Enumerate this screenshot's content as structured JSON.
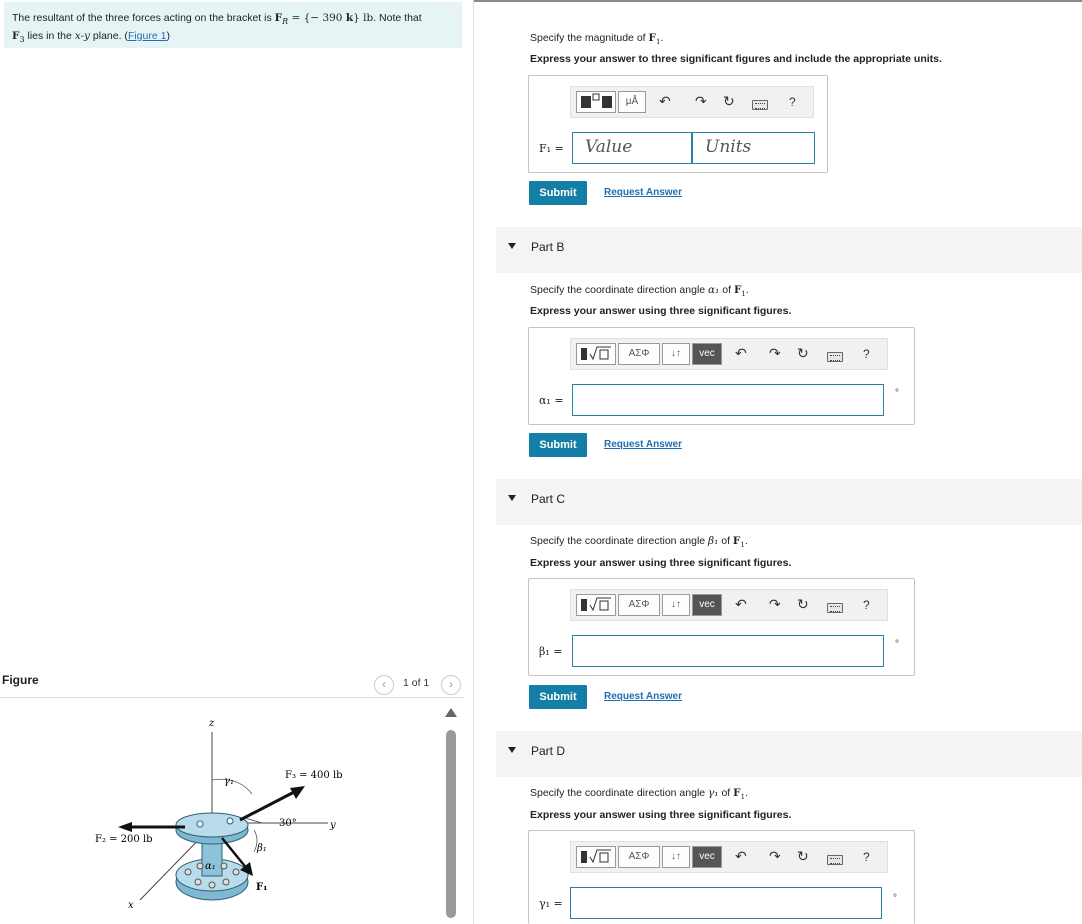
{
  "problem": {
    "text_1": "The resultant of the three forces acting on the bracket is ",
    "fr_symbol": "F",
    "fr_sub": "R",
    "fr_eq": " = {− 390 ",
    "k_symbol": "k",
    "fr_end": "} lb",
    "text_2": ". Note that",
    "f3_symbol": "F",
    "f3_sub": "3",
    "text_3": " lies in the ",
    "plane_var": "x-y",
    "text_4": " plane. (",
    "figure_link": "Figure 1",
    "text_5": ")"
  },
  "figure": {
    "title": "Figure",
    "counter": "1 of 1",
    "prev": "‹",
    "next": "›",
    "labels": {
      "z": "z",
      "gamma1": "γ₁",
      "f3": "F₃ = 400 lb",
      "angle30": "30°",
      "y": "y",
      "f2": "F₂ = 200 lb",
      "beta1": "β₁",
      "alpha1": "α₁",
      "f1": "F₁",
      "x": "x"
    }
  },
  "partA": {
    "prompt": "Specify the magnitude of ",
    "prompt_var": "F",
    "prompt_sub": "1",
    "prompt_end": ".",
    "instruction": "Express your answer to three significant figures and include the appropriate units.",
    "toolbar_units": "μÅ",
    "help": "?",
    "var_label": "F₁ =",
    "value_placeholder": "Value",
    "units_placeholder": "Units",
    "submit": "Submit",
    "request": "Request Answer"
  },
  "partB": {
    "title": "Part B",
    "prompt": "Specify the coordinate direction angle ",
    "angle": "α₁",
    "prompt_of": " of ",
    "prompt_var": "F",
    "prompt_sub": "1",
    "prompt_end": ".",
    "instruction": "Express your answer using three significant figures.",
    "tool_greek": "ΑΣΦ",
    "tool_arrows": "↓↑",
    "tool_vec": "vec",
    "help": "?",
    "var_label": "α₁ =",
    "degree": "°",
    "submit": "Submit",
    "request": "Request Answer"
  },
  "partC": {
    "title": "Part C",
    "prompt": "Specify the coordinate direction angle ",
    "angle": "β₁",
    "prompt_of": " of ",
    "prompt_var": "F",
    "prompt_sub": "1",
    "prompt_end": ".",
    "instruction": "Express your answer using three significant figures.",
    "tool_greek": "ΑΣΦ",
    "tool_arrows": "↓↑",
    "tool_vec": "vec",
    "help": "?",
    "var_label": "β₁ =",
    "degree": "°",
    "submit": "Submit",
    "request": "Request Answer"
  },
  "partD": {
    "title": "Part D",
    "prompt": "Specify the coordinate direction angle ",
    "angle": "γ₁",
    "prompt_of": " of ",
    "prompt_var": "F",
    "prompt_sub": "1",
    "prompt_end": ".",
    "instruction": "Express your answer using three significant figures.",
    "tool_greek": "ΑΣΦ",
    "tool_arrows": "↓↑",
    "tool_vec": "vec",
    "help": "?",
    "var_label": "γ₁ =",
    "degree": "°"
  },
  "icons": {
    "undo": "↶",
    "redo": "↷",
    "reset": "↻"
  },
  "colors": {
    "accent": "#137ea6",
    "problem_bg": "#e7f4f6",
    "link": "#1f6fb2",
    "field_border": "#2b7fa8"
  }
}
